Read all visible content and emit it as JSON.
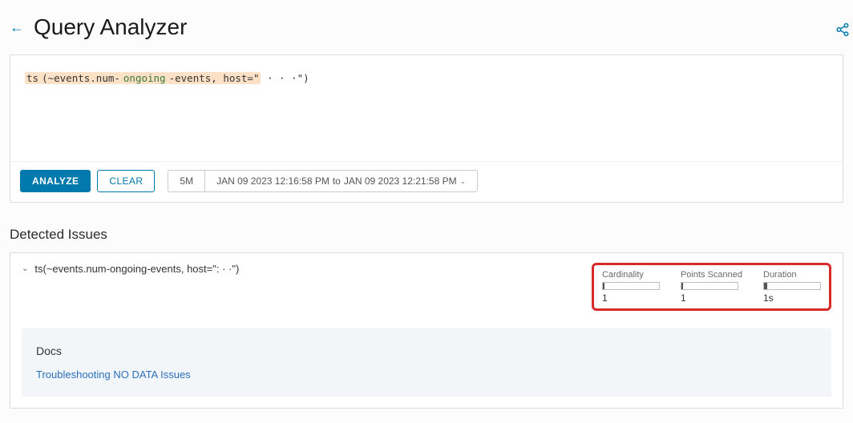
{
  "header": {
    "title": "Query Analyzer"
  },
  "query": {
    "prefix": "ts",
    "body_a": "(~events.num-",
    "body_b": "ongoing",
    "body_c": "-events, host=\"",
    "body_d": "   · · ·",
    "body_e": "\")"
  },
  "toolbar": {
    "analyze": "ANALYZE",
    "clear": "CLEAR",
    "duration_pill": "5M",
    "range_from": "JAN 09 2023 12:16:58 PM",
    "range_to_word": "to",
    "range_to": "JAN 09 2023 12:21:58 PM"
  },
  "detected": {
    "section_title": "Detected Issues",
    "row_text": "ts(~events.num-ongoing-events, host=\":   · ·\")"
  },
  "metrics": {
    "cardinality": {
      "label": "Cardinality",
      "value": "1"
    },
    "points_scanned": {
      "label": "Points Scanned",
      "value": "1"
    },
    "duration": {
      "label": "Duration",
      "value": "1s"
    }
  },
  "docs": {
    "title": "Docs",
    "link": "Troubleshooting NO DATA Issues"
  }
}
